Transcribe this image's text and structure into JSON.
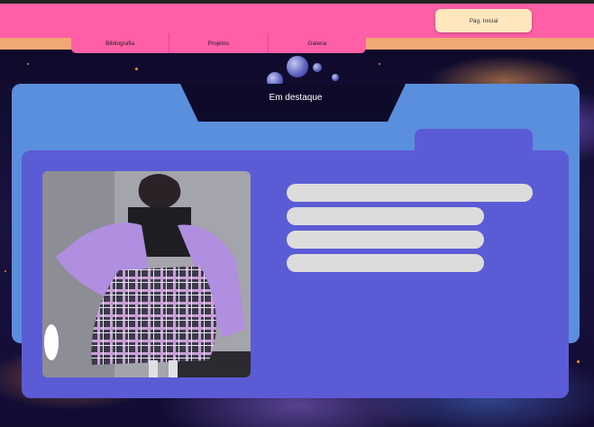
{
  "header": {
    "nav": [
      {
        "label": "Bibliografia"
      },
      {
        "label": "Projetos"
      },
      {
        "label": "Galeria"
      }
    ],
    "home_label": "Pág. Inicial"
  },
  "featured": {
    "title": "Em destaque",
    "image_icon": "featured-photo",
    "text_lines": 4
  },
  "colors": {
    "header": "#ff5fa6",
    "stripe": "#f2a874",
    "home_button": "#ffe6bd",
    "folder_back": "#5a8fdd",
    "folder_front": "#5b5bd6",
    "placeholder": "#dcdcdc"
  }
}
